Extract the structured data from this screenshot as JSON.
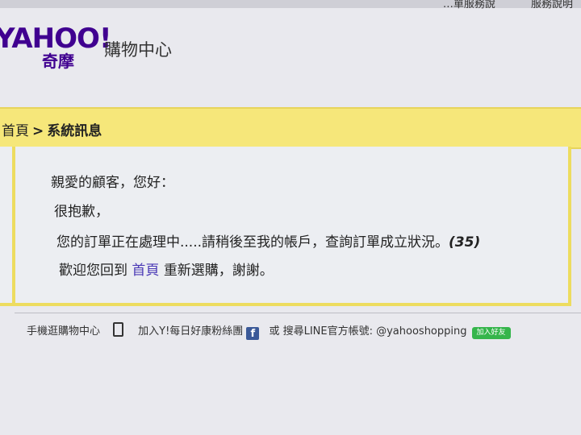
{
  "topbar": {
    "link1": "…單服務說",
    "link2": "服務說明"
  },
  "brand": {
    "logo_text": "YAHOO!",
    "logo_sub": "奇摩",
    "site_title": "購物中心"
  },
  "breadcrumb": {
    "home": "首頁",
    "separator": ">",
    "current": "系統訊息"
  },
  "message": {
    "greeting": "親愛的顧客，您好：",
    "apology": "很抱歉，",
    "body": "您的訂單正在處理中.....請稍後至我的帳戶，查詢訂單成立狀況。",
    "code": "(35)",
    "back_prefix": "歡迎您回到",
    "back_link": "首頁",
    "back_suffix": "重新選購，謝謝。"
  },
  "footer": {
    "mobile": "手機逛購物中心",
    "fb_text": "加入Y!每日好康粉絲團",
    "fb_icon": "f",
    "or_line": "或 搜尋LINE官方帳號: @yahooshopping",
    "line_button": "加入好友"
  },
  "colors": {
    "brand": "#400090",
    "highlight": "#f6e77a",
    "link": "#4b3ab6"
  }
}
